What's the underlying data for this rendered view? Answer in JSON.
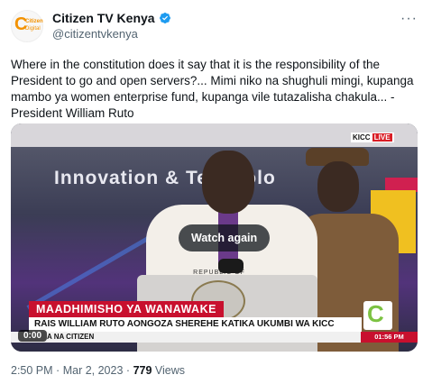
{
  "account": {
    "name": "Citizen TV Kenya",
    "handle": "@citizentvkenya",
    "avatar_text_line1": "Citizen",
    "avatar_text_line2": "Digital"
  },
  "tweet": {
    "text": "Where in the constitution does it say that it is the responsibility of the President to go and open servers?... Mimi niko na shughuli mingi, kupanga mambo ya women enterprise fund, kupanga vile tutazalisha chakula... - President William Ruto",
    "time": "2:50 PM",
    "date": "Mar 2, 2023",
    "views_count": "779",
    "views_label": "Views",
    "separator": "·"
  },
  "video": {
    "watch_again_label": "Watch again",
    "timecode": "0:00",
    "kicc_badge": "KICC",
    "live_badge": "LIVE",
    "backdrop_text": "Innovation & Technolo",
    "podium_text": "REPUBLIC OF",
    "lower_third_title": "MAADHIMISHO YA WANAWAKE",
    "lower_third_subtitle": "RAIS WILLIAM RUTO AONGOZA SHEREHE KATIKA UKUMBI WA KICC",
    "ticker_text": "A NA CITIZEN",
    "ticker_time": "01:56 PM",
    "channel_logo": "C"
  },
  "icons": {
    "verified": "verified-badge-icon",
    "more": "more-options-icon"
  },
  "colors": {
    "verified_blue": "#1d9bf0",
    "citizen_orange": "#f39200",
    "lower_third_red": "#c8102e",
    "citizen_green": "#7cc242"
  }
}
